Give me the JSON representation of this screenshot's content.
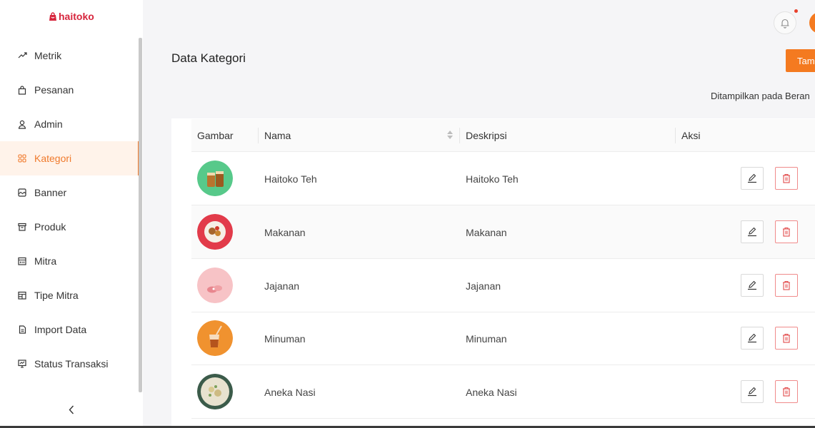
{
  "brand": {
    "name": "haitoko",
    "color": "#d7263d"
  },
  "accent_color": "#f47a20",
  "sidebar": {
    "items": [
      {
        "label": "Metrik",
        "icon": "trend-up-icon",
        "active": false
      },
      {
        "label": "Pesanan",
        "icon": "shopping-bag-icon",
        "active": false
      },
      {
        "label": "Admin",
        "icon": "user-icon",
        "active": false
      },
      {
        "label": "Kategori",
        "icon": "grid-icon",
        "active": true
      },
      {
        "label": "Banner",
        "icon": "image-icon",
        "active": false
      },
      {
        "label": "Produk",
        "icon": "box-icon",
        "active": false
      },
      {
        "label": "Mitra",
        "icon": "bank-icon",
        "active": false
      },
      {
        "label": "Tipe Mitra",
        "icon": "layout-icon",
        "active": false
      },
      {
        "label": "Import Data",
        "icon": "file-icon",
        "active": false
      },
      {
        "label": "Status Transaksi",
        "icon": "chart-board-icon",
        "active": false
      }
    ],
    "collapse_icon": "chevron-left-icon"
  },
  "header": {
    "bell_icon": "bell-icon",
    "has_notification": true
  },
  "main": {
    "title": "Data Kategori",
    "add_button_label": "Tam",
    "shown_on_label": "Ditampilkan pada Beran",
    "table": {
      "columns": [
        "Gambar",
        "Nama",
        "Deskripsi",
        "Aksi"
      ],
      "rows": [
        {
          "name": "Haitoko Teh",
          "description": "Haitoko Teh",
          "thumb": "tea-thumb"
        },
        {
          "name": "Makanan",
          "description": "Makanan",
          "thumb": "food-thumb"
        },
        {
          "name": "Jajanan",
          "description": "Jajanan",
          "thumb": "snack-thumb"
        },
        {
          "name": "Minuman",
          "description": "Minuman",
          "thumb": "drink-thumb"
        },
        {
          "name": "Aneka Nasi",
          "description": "Aneka Nasi",
          "thumb": "rice-thumb"
        }
      ]
    }
  }
}
